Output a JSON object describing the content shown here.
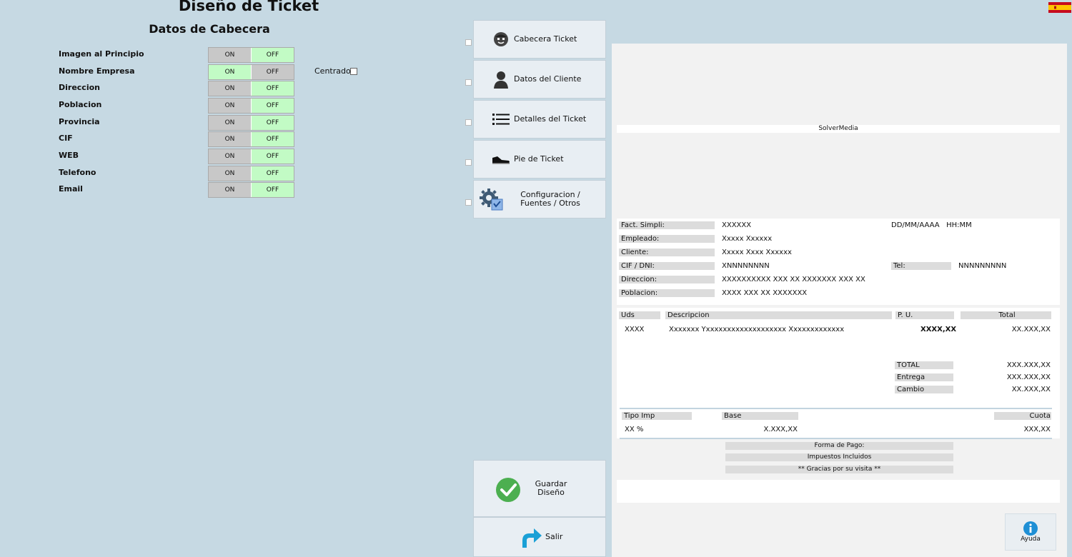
{
  "page_title": "Diseño de Ticket",
  "section_title": "Datos de Cabecera",
  "language_flag": "spain-flag",
  "header_fields": [
    {
      "label": "Imagen al Principio",
      "on": "ON",
      "off": "OFF",
      "selected": "off"
    },
    {
      "label": "Nombre Empresa",
      "on": "ON",
      "off": "OFF",
      "selected": "on"
    },
    {
      "label": "Direccion",
      "on": "ON",
      "off": "OFF",
      "selected": "off"
    },
    {
      "label": "Poblacion",
      "on": "ON",
      "off": "OFF",
      "selected": "off"
    },
    {
      "label": "Provincia",
      "on": "ON",
      "off": "OFF",
      "selected": "off"
    },
    {
      "label": "CIF",
      "on": "ON",
      "off": "OFF",
      "selected": "off"
    },
    {
      "label": "WEB",
      "on": "ON",
      "off": "OFF",
      "selected": "off"
    },
    {
      "label": "Telefono",
      "on": "ON",
      "off": "OFF",
      "selected": "off"
    },
    {
      "label": "Email",
      "on": "ON",
      "off": "OFF",
      "selected": "off"
    }
  ],
  "centrado_label": "Centrado",
  "nav": [
    {
      "label": "Cabecera Ticket",
      "icon": "header-face-icon"
    },
    {
      "label": "Datos del Cliente",
      "icon": "client-person-icon"
    },
    {
      "label": "Detalles del Ticket",
      "icon": "list-icon"
    },
    {
      "label": "Pie de Ticket",
      "icon": "shoe-icon"
    },
    {
      "label": "Configuracion / Fuentes / Otros",
      "icon": "settings-gear-icon"
    }
  ],
  "save_label_1": "Guardar",
  "save_label_2": "Diseño",
  "exit_label": "Salir",
  "help_label": "Ayuda",
  "colors": {
    "accent_green": "#4caf50",
    "exit_blue": "#1aa0d6",
    "help_blue": "#1e8fd5"
  },
  "ticket": {
    "company": "SolverMedia",
    "fact_label": "Fact. Simpli:",
    "fact_value": "XXXXXX",
    "datetime": "DD/MM/AAAA   HH:MM",
    "empleado_label": "Empleado:",
    "empleado_value": "Xxxxx Xxxxxx",
    "cliente_label": "Cliente:",
    "cliente_value": "Xxxxx Xxxx Xxxxxx",
    "cif_label": "CIF / DNI:",
    "cif_value": "XNNNNNNNN",
    "tel_label": "Tel:",
    "tel_value": "NNNNNNNNN",
    "direccion_label": "Direccion:",
    "direccion_value": "XXXXXXXXXX XXX XX XXXXXXX XXX XX",
    "poblacion_label": "Poblacion:",
    "poblacion_value": "XXXX XXX XX XXXXXXX",
    "col_uds": "Uds",
    "col_desc": "Descripcion",
    "col_pu": "P. U.",
    "col_total": "Total",
    "line_uds": "XXXX",
    "line_desc": "Xxxxxxx Yxxxxxxxxxxxxxxxxxxx Xxxxxxxxxxxxx",
    "line_pu": "XXXX,XX",
    "line_total": "XX.XXX,XX",
    "total_label": "TOTAL",
    "total_value": "XXX.XXX,XX",
    "entrega_label": "Entrega",
    "entrega_value": "XXX.XXX,XX",
    "cambio_label": "Cambio",
    "cambio_value": "XX.XXX,XX",
    "tipo_imp_label": "Tipo Imp",
    "base_label": "Base",
    "cuota_label": "Cuota",
    "tipo_imp_value": "XX %",
    "base_value": "X.XXX,XX",
    "cuota_value": "XXX,XX",
    "forma_pago": "Forma de Pago:",
    "impuestos": "Impuestos Incluidos",
    "gracias": "** Gracias por su visita **"
  }
}
